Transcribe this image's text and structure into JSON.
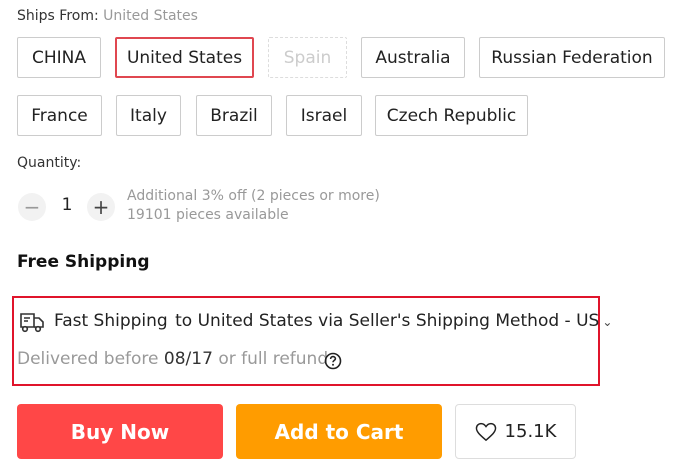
{
  "ships_from": {
    "label": "Ships From:",
    "selected": "United States"
  },
  "ship_options": [
    {
      "label": "CHINA"
    },
    {
      "label": "United States"
    },
    {
      "label": "Spain"
    },
    {
      "label": "Australia"
    },
    {
      "label": "Russian Federation"
    },
    {
      "label": "France"
    },
    {
      "label": "Italy"
    },
    {
      "label": "Brazil"
    },
    {
      "label": "Israel"
    },
    {
      "label": "Czech Republic"
    }
  ],
  "quantity": {
    "label": "Quantity:",
    "minus": "−",
    "value": "1",
    "plus": "+",
    "discount_note": "Additional 3% off (2 pieces or more)",
    "available": "19101 pieces available"
  },
  "shipping": {
    "free_label": "Free Shipping",
    "fast_label": "Fast Shipping",
    "method_text": "to United States via Seller's Shipping Method - US",
    "chevron": "⌄",
    "delivered_prefix": "Delivered before",
    "delivered_date": "08/17",
    "delivered_suffix": "or full refund"
  },
  "actions": {
    "buy_now": "Buy Now",
    "add_to_cart": "Add to Cart",
    "wishlist_count": "15.1K"
  },
  "colors": {
    "buy": "#ff4747",
    "cart": "#ff9c00",
    "selected_border": "#e04750",
    "highlight_box": "#e0142b"
  },
  "icons": [
    "truck-icon",
    "help-circle-icon",
    "heart-icon"
  ]
}
